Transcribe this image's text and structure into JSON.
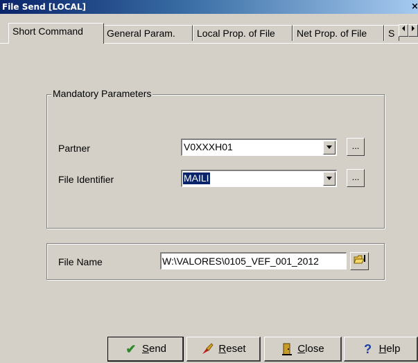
{
  "window": {
    "title": "File Send [LOCAL]",
    "close_glyph": "×"
  },
  "tabs": [
    {
      "label": "Short Command",
      "active": true
    },
    {
      "label": "General Param."
    },
    {
      "label": "Local Prop. of File"
    },
    {
      "label": "Net Prop. of File"
    },
    {
      "label": "S"
    }
  ],
  "tab_scroll": {
    "left_icon": "triangle-left-icon",
    "right_icon": "triangle-right-icon"
  },
  "mandatory": {
    "legend": "Mandatory Parameters",
    "partner": {
      "label": "Partner",
      "value": "V0XXXH01"
    },
    "file_identifier": {
      "label": "File Identifier",
      "value": "MAILI"
    },
    "browse_label": "..."
  },
  "file_name": {
    "label": "File Name",
    "value": "W:\\VALORES\\0105_VEF_001_2012",
    "icon": "folder-browse-icon"
  },
  "buttons": {
    "send": {
      "mnemonic": "S",
      "rest": "end",
      "icon": "checkmark-icon"
    },
    "reset": {
      "mnemonic": "R",
      "rest": "eset",
      "icon": "brush-icon"
    },
    "close": {
      "mnemonic": "C",
      "rest": "lose",
      "icon": "door-exit-icon"
    },
    "help": {
      "mnemonic": "H",
      "rest": "elp",
      "icon": "question-icon"
    }
  },
  "colors": {
    "accent": "#0a246a",
    "window_bg": "#d4d0c8",
    "send_icon": "#2a8a2a",
    "help_icon": "#1a3fa0"
  }
}
